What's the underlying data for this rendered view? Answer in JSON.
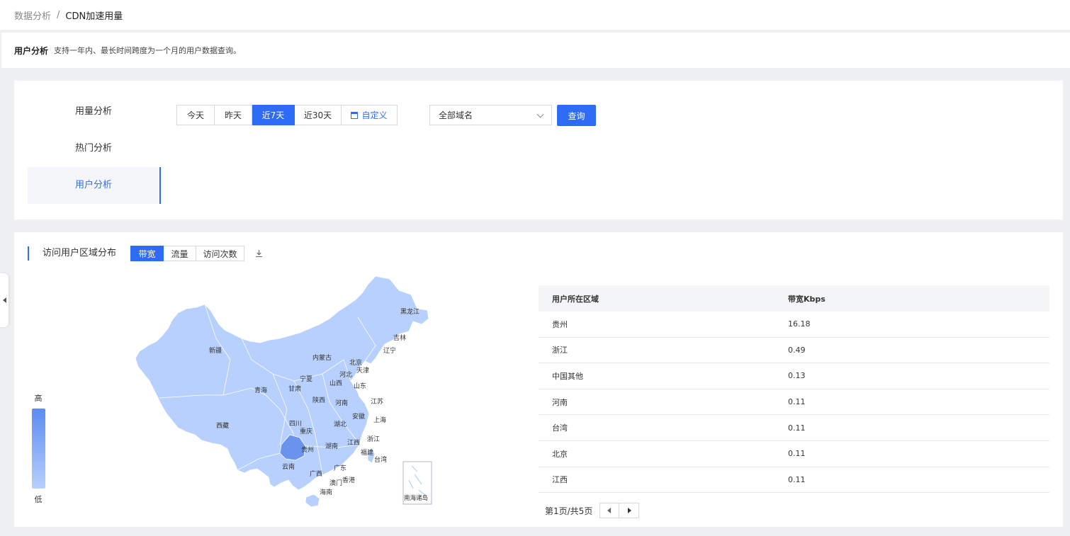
{
  "breadcrumb": {
    "parent": "数据分析",
    "separator": "/",
    "current": "CDN加速用量"
  },
  "intro": {
    "title": "用户分析",
    "description": "支持一年内、最长时间跨度为一个月的用户数据查询。"
  },
  "nav": {
    "items": [
      {
        "label": "用量分析",
        "active": false
      },
      {
        "label": "热门分析",
        "active": false
      },
      {
        "label": "用户分析",
        "active": true
      }
    ]
  },
  "date_range": {
    "options": [
      "今天",
      "昨天",
      "近7天",
      "近30天"
    ],
    "custom_label": "自定义",
    "selected": "近7天"
  },
  "domain_select": {
    "value": "全部域名"
  },
  "query_button": {
    "label": "查询"
  },
  "map_card": {
    "title": "访问用户区域分布",
    "metrics": [
      "带宽",
      "流量",
      "访问次数"
    ],
    "selected_metric": "带宽",
    "legend": {
      "high": "高",
      "low": "低",
      "high_color": "#5b8cf0",
      "low_color": "#b7d0fd"
    },
    "highlight_color": "#6b93ee",
    "map_labels": {
      "heilongjiang": "黑龙江",
      "jilin": "吉林",
      "liaoning": "辽宁",
      "neimenggu": "内蒙古",
      "xinjiang": "新疆",
      "beijing": "北京",
      "tianjin": "天津",
      "hebei": "河北",
      "ningxia": "宁夏",
      "shanxi": "山西",
      "shandong": "山东",
      "gansu": "甘肃",
      "qinghai": "青海",
      "shaanxi": "陕西",
      "henan": "河南",
      "jiangsu": "江苏",
      "anhui": "安徽",
      "xizang": "西藏",
      "sichuan": "四川",
      "hubei": "湖北",
      "shanghai": "上海",
      "chongqing": "重庆",
      "zhejiang": "浙江",
      "guizhou": "贵州",
      "hunan": "湖南",
      "jiangxi": "江西",
      "fujian": "福建",
      "yunnan": "云南",
      "guangxi": "广西",
      "guangdong": "广东",
      "taiwan": "台湾",
      "aomen": "澳门",
      "xianggang": "香港",
      "hainan": "海南",
      "nanhai": "南海诸岛"
    }
  },
  "table": {
    "headers": [
      "用户所在区域",
      "带宽Kbps"
    ],
    "rows": [
      [
        "贵州",
        "16.18"
      ],
      [
        "浙江",
        "0.49"
      ],
      [
        "中国其他",
        "0.13"
      ],
      [
        "河南",
        "0.11"
      ],
      [
        "台湾",
        "0.11"
      ],
      [
        "北京",
        "0.11"
      ],
      [
        "江西",
        "0.11"
      ]
    ]
  },
  "pagination": {
    "text": "第1页/共5页"
  }
}
